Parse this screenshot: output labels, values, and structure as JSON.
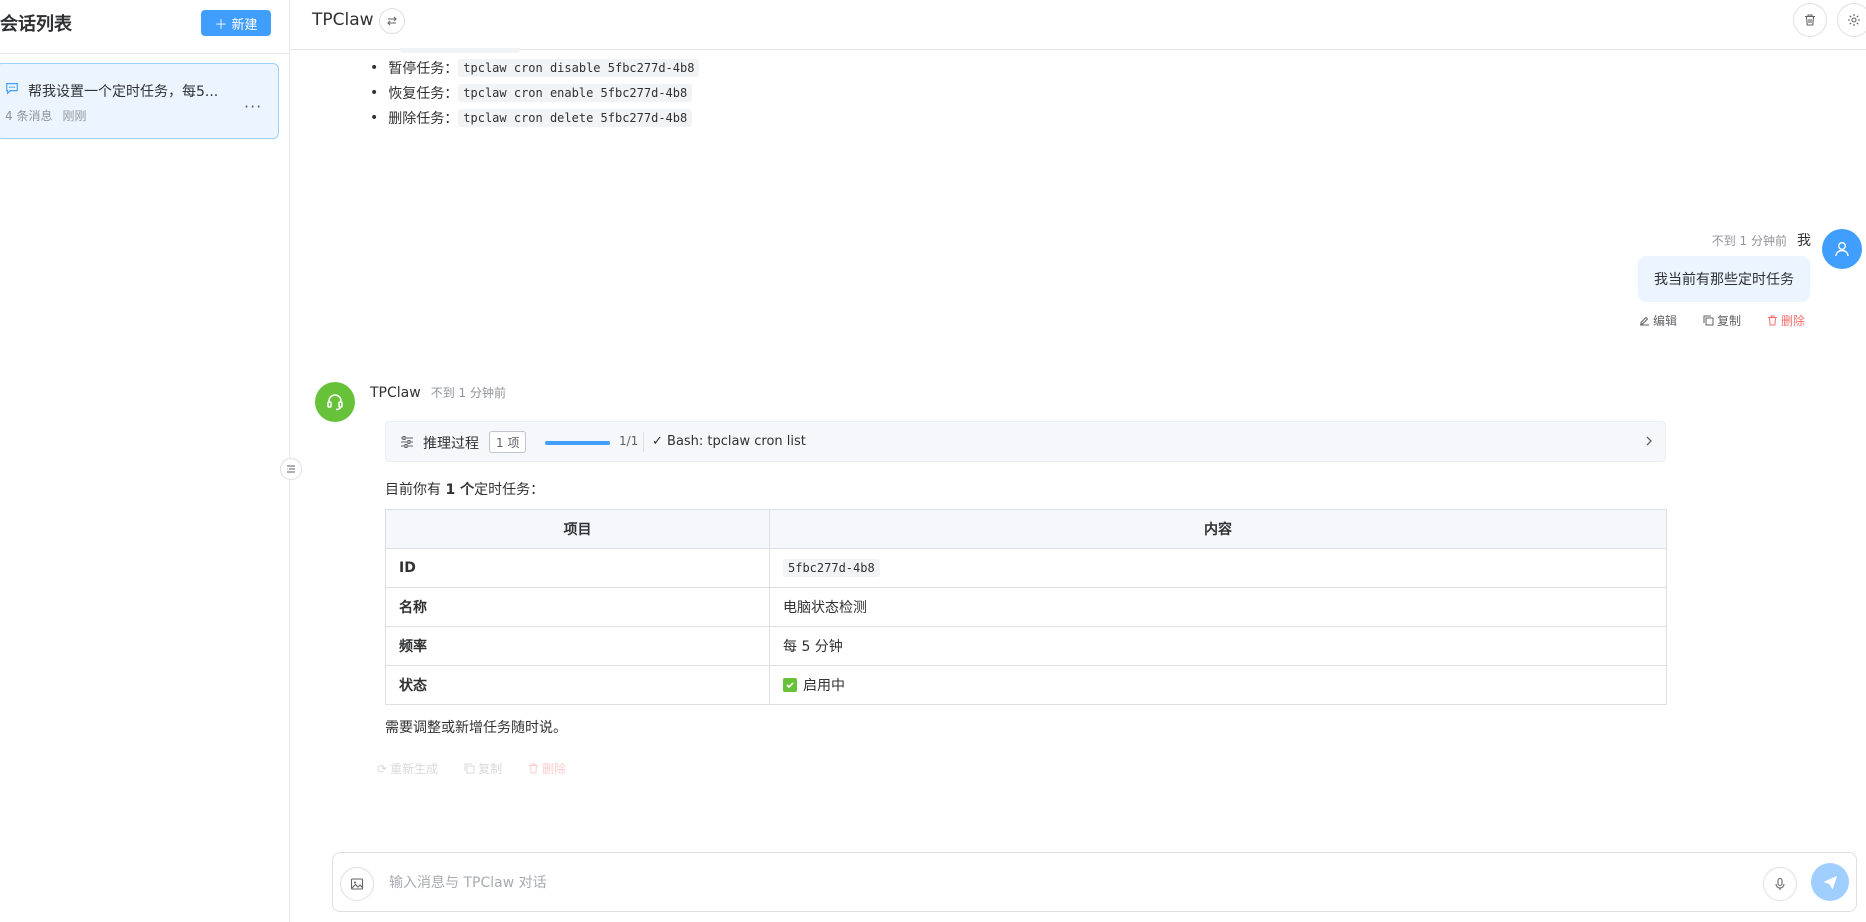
{
  "sidebar": {
    "title": "会话列表",
    "new_button": "新建",
    "conversations": [
      {
        "title": "帮我设置一个定时任务，每5...",
        "count": "4 条消息",
        "time": "刚刚"
      }
    ]
  },
  "header": {
    "title": "TPClaw"
  },
  "commands": [
    {
      "label": "暂停任务：",
      "code": "tpclaw cron disable 5fbc277d-4b8"
    },
    {
      "label": "恢复任务：",
      "code": "tpclaw cron enable 5fbc277d-4b8"
    },
    {
      "label": "删除任务：",
      "code": "tpclaw cron delete 5fbc277d-4b8"
    }
  ],
  "user_message": {
    "time": "不到 1 分钟前",
    "name": "我",
    "text": "我当前有那些定时任务",
    "actions": {
      "edit": "编辑",
      "copy": "复制",
      "delete": "删除"
    }
  },
  "bot_message": {
    "name": "TPClaw",
    "time": "不到 1 分钟前",
    "reasoning": {
      "label": "推理过程",
      "count": "1 项",
      "progress_fraction": 1.0,
      "progress_text": "1/1",
      "step": "✓ Bash: tpclaw cron list"
    },
    "intro_before": "目前你有 ",
    "intro_bold": "1 个",
    "intro_after": "定时任务：",
    "table": {
      "headers": [
        "项目",
        "内容"
      ],
      "rows": [
        {
          "key": "ID",
          "value": "5fbc277d-4b8"
        },
        {
          "key": "名称",
          "value": "电脑状态检测"
        },
        {
          "key": "频率",
          "value": "每 5 分钟"
        },
        {
          "key": "状态",
          "value": "启用中"
        }
      ]
    },
    "outro": "需要调整或新增任务随时说。",
    "actions": {
      "regenerate": "重新生成",
      "copy": "复制",
      "delete": "删除"
    }
  },
  "input": {
    "placeholder": "输入消息与 TPClaw 对话"
  },
  "colors": {
    "accent": "#409eff",
    "bot": "#67c23a",
    "danger": "#f56c6c"
  }
}
